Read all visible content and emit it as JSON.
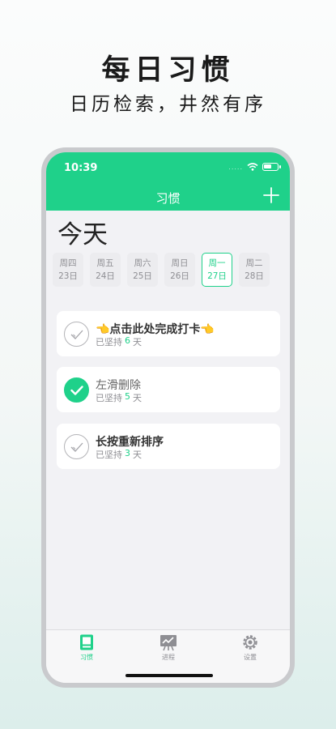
{
  "promo": {
    "title": "每日习惯",
    "subtitle": "日历检索，井然有序"
  },
  "status_bar": {
    "time": "10:39",
    "signal": "....."
  },
  "nav": {
    "title": "习惯",
    "add_icon": "plus-icon"
  },
  "today_label": "今天",
  "date_strip": {
    "days": [
      {
        "weekday": "周四",
        "date": "23日"
      },
      {
        "weekday": "周五",
        "date": "24日"
      },
      {
        "weekday": "周六",
        "date": "25日"
      },
      {
        "weekday": "周日",
        "date": "26日"
      },
      {
        "weekday": "周一",
        "date": "27日",
        "selected": true
      },
      {
        "weekday": "周二",
        "date": "28日"
      }
    ]
  },
  "habits": [
    {
      "name": "👈点击此处完成打卡👈",
      "streak_prefix": "已坚持",
      "streak_count": "6",
      "streak_suffix": "天",
      "done": false
    },
    {
      "name": "左滑删除",
      "streak_prefix": "已坚持",
      "streak_count": "5",
      "streak_suffix": "天",
      "done": true
    },
    {
      "name": "长按重新排序",
      "streak_prefix": "已坚持",
      "streak_count": "3",
      "streak_suffix": "天",
      "done": false
    }
  ],
  "tabbar": {
    "tabs": [
      {
        "label": "习惯",
        "icon": "habit-icon",
        "active": true
      },
      {
        "label": "进程",
        "icon": "progress-chart-icon",
        "active": false
      },
      {
        "label": "设置",
        "icon": "gear-icon",
        "active": false
      }
    ]
  },
  "colors": {
    "accent": "#1fd18a",
    "background": "#f2f2f5"
  }
}
